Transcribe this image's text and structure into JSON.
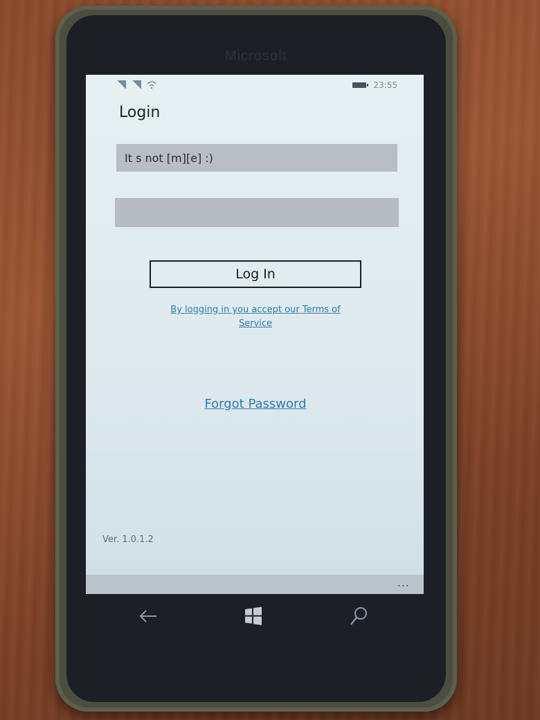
{
  "device": {
    "brand": "Microsoft"
  },
  "status_bar": {
    "time": "23:55"
  },
  "login": {
    "title": "Login",
    "username_value": "It s not [m][e] :)",
    "password_value": "",
    "login_button": "Log In",
    "terms_text": "By logging in you accept our Terms of Service",
    "forgot_password": "Forgot Password",
    "version": "Ver. 1.0.1.2"
  },
  "app_bar": {
    "more_label": "..."
  },
  "nav": {
    "icons": [
      "back-icon",
      "windows-start-icon",
      "search-icon"
    ]
  }
}
